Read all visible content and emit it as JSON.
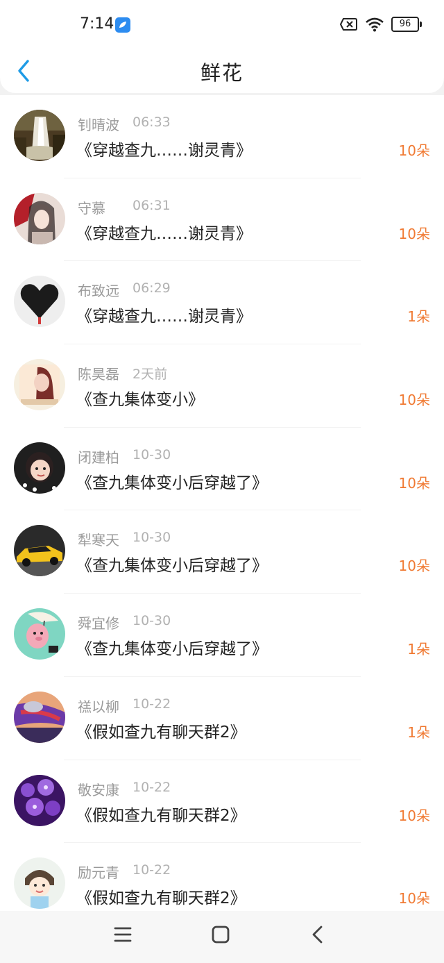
{
  "status_bar": {
    "time": "7:14",
    "battery": "96",
    "icons": [
      "app-notification-icon",
      "no-sim-icon",
      "wifi-icon",
      "battery-icon"
    ]
  },
  "header": {
    "title": "鲜花",
    "back_icon": "chevron-left-icon"
  },
  "colors": {
    "accent": "#f07a33",
    "back_icon": "#1e9be6"
  },
  "items": [
    {
      "user": "钊晴波",
      "time": "06:33",
      "book": "《穿越查九……谢灵青》",
      "count": "10朵",
      "avatar": "waterfall"
    },
    {
      "user": "守慕",
      "time": "06:31",
      "book": "《穿越查九……谢灵青》",
      "count": "10朵",
      "avatar": "portrait-red"
    },
    {
      "user": "布致远",
      "time": "06:29",
      "book": "《穿越查九……谢灵青》",
      "count": "1朵",
      "avatar": "black-heart"
    },
    {
      "user": "陈昊磊",
      "time": "2天前",
      "book": "《查九集体变小》",
      "count": "10朵",
      "avatar": "girl-photo"
    },
    {
      "user": "闭建柏",
      "time": "10-30",
      "book": "《查九集体变小后穿越了》",
      "count": "10朵",
      "avatar": "child"
    },
    {
      "user": "犁寒天",
      "time": "10-30",
      "book": "《查九集体变小后穿越了》",
      "count": "10朵",
      "avatar": "yellow-car"
    },
    {
      "user": "舜宜修",
      "time": "10-30",
      "book": "《查九集体变小后穿越了》",
      "count": "1朵",
      "avatar": "cartoon-pig"
    },
    {
      "user": "禚以柳",
      "time": "10-22",
      "book": "《假如查九有聊天群2》",
      "count": "1朵",
      "avatar": "game-character"
    },
    {
      "user": "敬安康",
      "time": "10-22",
      "book": "《假如查九有聊天群2》",
      "count": "10朵",
      "avatar": "purple-flowers"
    },
    {
      "user": "励元青",
      "time": "10-22",
      "book": "《假如查九有聊天群2》",
      "count": "10朵",
      "avatar": "cartoon-girl"
    }
  ],
  "nav": [
    "menu-icon",
    "home-icon",
    "back-icon"
  ]
}
